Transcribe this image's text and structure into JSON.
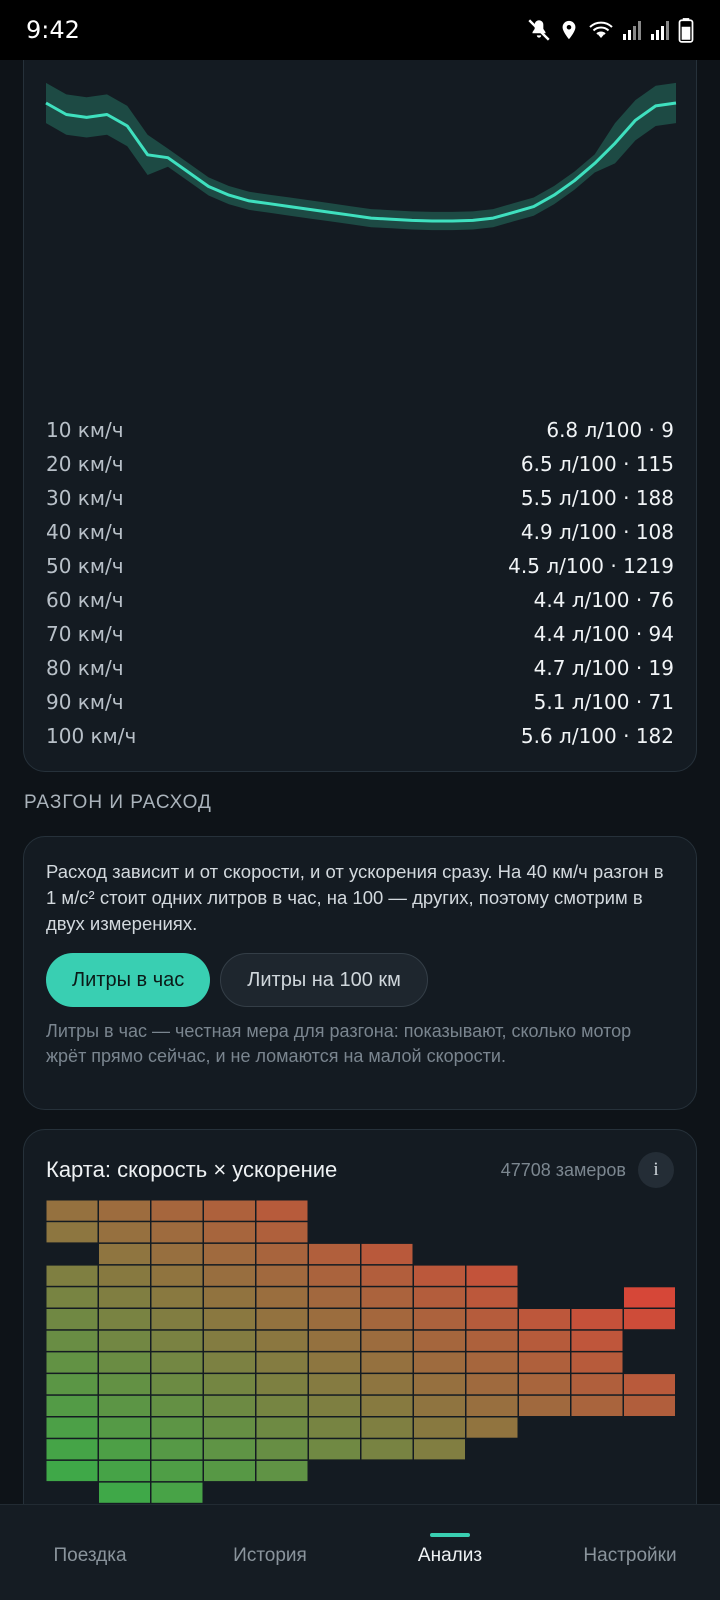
{
  "status_bar": {
    "time": "9:42"
  },
  "speed_card": {
    "rows": [
      {
        "speed": "10 км/ч",
        "value": "6.8 л/100 · 9"
      },
      {
        "speed": "20 км/ч",
        "value": "6.5 л/100 · 115"
      },
      {
        "speed": "30 км/ч",
        "value": "5.5 л/100 · 188"
      },
      {
        "speed": "40 км/ч",
        "value": "4.9 л/100 · 108"
      },
      {
        "speed": "50 км/ч",
        "value": "4.5 л/100 · 1219"
      },
      {
        "speed": "60 км/ч",
        "value": "4.4 л/100 · 76"
      },
      {
        "speed": "70 км/ч",
        "value": "4.4 л/100 · 94"
      },
      {
        "speed": "80 км/ч",
        "value": "4.7 л/100 · 19"
      },
      {
        "speed": "90 км/ч",
        "value": "5.1 л/100 · 71"
      },
      {
        "speed": "100 км/ч",
        "value": "5.6 л/100 · 182"
      }
    ],
    "curve_color": "#3fe0bf",
    "band_color": "#1d4a44"
  },
  "accel_section": {
    "title": "РАЗГОН И РАСХОД",
    "description": "Расход зависит и от скорости, и от ускорения сразу. На 40 км/ч разгон в 1 м/с² стоит одних литров в час, на 100 — других, поэтому смотрим в двух измерениях.",
    "toggle_lph": "Литры в час",
    "toggle_l100": "Литры на 100 км",
    "selected": "lph",
    "hint": "Литры в час — честная мера для разгона: показывают, сколько мотор жрёт прямо сейчас, и не ломаются на малой скорости."
  },
  "map_card": {
    "title": "Карта: скорость × ускорение",
    "count": "47708 замеров",
    "info": "i"
  },
  "nav": {
    "items": [
      {
        "label": "Поездка",
        "active": false
      },
      {
        "label": "История",
        "active": false
      },
      {
        "label": "Анализ",
        "active": true
      },
      {
        "label": "Настройки",
        "active": false
      }
    ],
    "accent": "#39cfb2"
  },
  "chart_data": {
    "type": "line",
    "series": [
      {
        "values": [
          6.8,
          6.6,
          6.55,
          6.6,
          6.4,
          5.9,
          5.85,
          5.6,
          5.35,
          5.2,
          5.1,
          5.05,
          5.0,
          4.95,
          4.9,
          4.85,
          4.8,
          4.78,
          4.76,
          4.75,
          4.75,
          4.76,
          4.8,
          4.9,
          5.0,
          5.2,
          5.45,
          5.75,
          6.1,
          6.5,
          6.75,
          6.8
        ]
      }
    ],
    "band_width": 0.35
  },
  "heatmap_data": {
    "type": "heatmap",
    "columns": 12,
    "rows": 14,
    "column_ranges": [
      [
        0,
        12
      ],
      [
        0,
        13
      ],
      [
        0,
        13
      ],
      [
        0,
        12
      ],
      [
        0,
        12
      ],
      [
        2,
        11
      ],
      [
        2,
        11
      ],
      [
        3,
        11
      ],
      [
        3,
        10
      ],
      [
        5,
        9
      ],
      [
        5,
        9
      ],
      [
        4,
        9
      ]
    ],
    "gaps": [
      [
        0,
        [
          2
        ]
      ],
      [
        11,
        [
          6,
          7
        ]
      ]
    ],
    "color_low": "#3fa848",
    "color_high": "#ea3a36"
  }
}
